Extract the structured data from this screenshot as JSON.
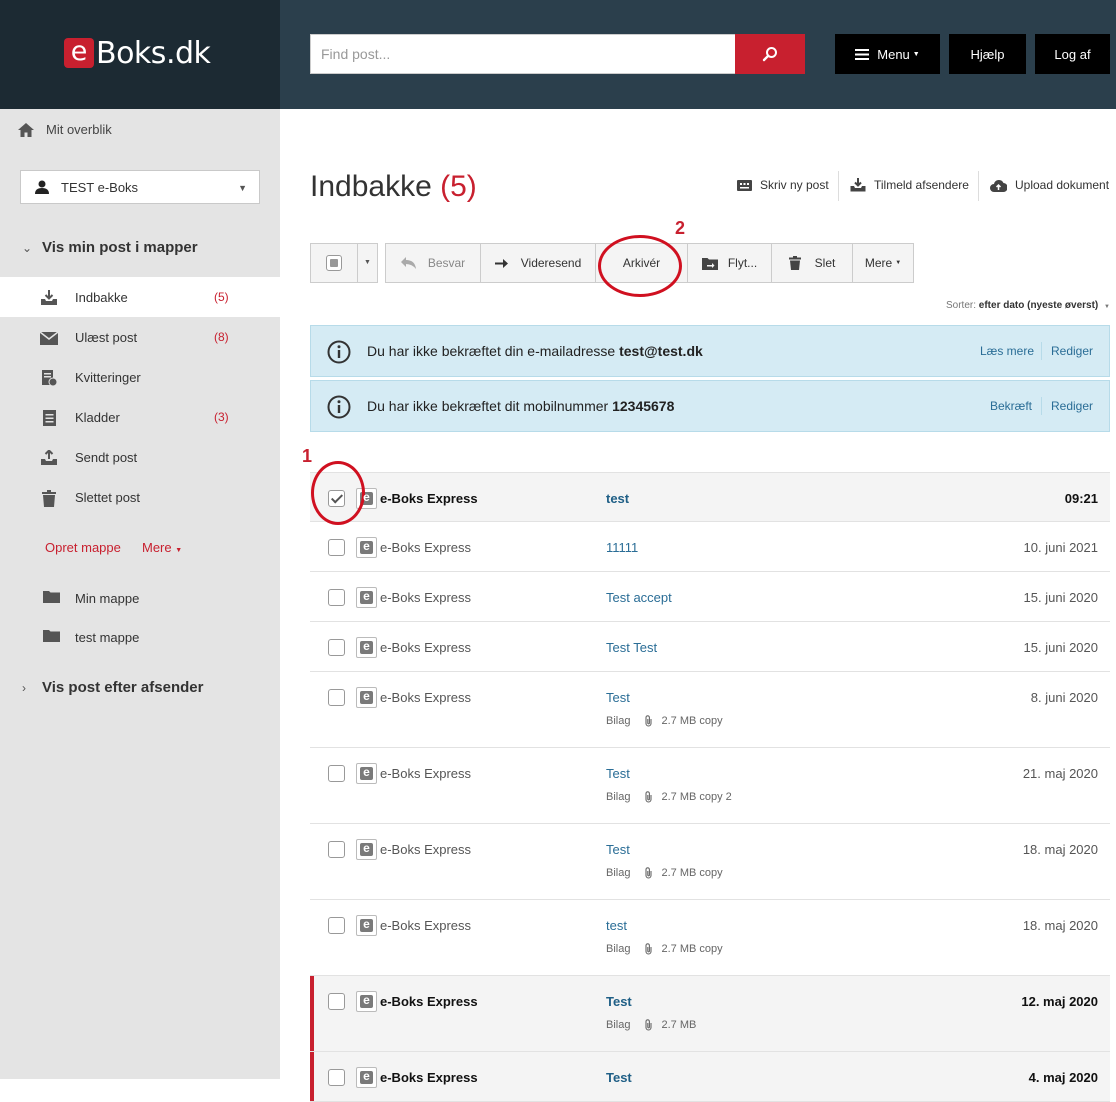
{
  "brand": {
    "e": "e",
    "rest": "Boks.dk"
  },
  "header": {
    "search_placeholder": "Find post...",
    "menu_label": "Menu",
    "help_label": "Hjælp",
    "logout_label": "Log af"
  },
  "sidebar": {
    "home_label": "Mit overblik",
    "user_label": "TEST e-Boks",
    "section_folders": "Vis min post i mapper",
    "items": [
      {
        "label": "Indbakke",
        "count": "(5)",
        "icon": "inbox-download-icon"
      },
      {
        "label": "Ulæst post",
        "count": "(8)",
        "icon": "envelope-icon"
      },
      {
        "label": "Kvitteringer",
        "count": "",
        "icon": "receipt-icon"
      },
      {
        "label": "Kladder",
        "count": "(3)",
        "icon": "draft-icon"
      },
      {
        "label": "Sendt post",
        "count": "",
        "icon": "upload-icon"
      },
      {
        "label": "Slettet post",
        "count": "",
        "icon": "trash-icon"
      }
    ],
    "create_folder": "Opret mappe",
    "more": "Mere",
    "folders": [
      "Min mappe",
      "test mappe"
    ],
    "section_sender": "Vis post efter afsender"
  },
  "main": {
    "title": "Indbakke",
    "title_count": "(5)",
    "actions": {
      "write": "Skriv ny post",
      "subscribe": "Tilmeld afsendere",
      "upload": "Upload dokument"
    },
    "toolbar": {
      "reply": "Besvar",
      "forward": "Videresend",
      "archive": "Arkivér",
      "move": "Flyt...",
      "delete": "Slet",
      "more": "Mere"
    },
    "sort_key": "Sorter:",
    "sort_value": "efter dato (nyeste øverst)",
    "notices": [
      {
        "text": "Du har ikke bekræftet din e-mailadresse ",
        "value": "test@test.dk",
        "link1": "Læs mere",
        "link2": "Rediger"
      },
      {
        "text": "Du har ikke bekræftet dit mobilnummer ",
        "value": "12345678",
        "link1": "Bekræft",
        "link2": "Rediger"
      }
    ],
    "messages": [
      {
        "sender": "e-Boks Express",
        "subject": "test",
        "date": "09:21",
        "unread": true,
        "checked": true,
        "attachment": ""
      },
      {
        "sender": "e-Boks Express",
        "subject": "11111",
        "date": "10. juni 2021",
        "unread": false,
        "checked": false,
        "attachment": ""
      },
      {
        "sender": "e-Boks Express",
        "subject": "Test accept",
        "date": "15. juni 2020",
        "unread": false,
        "checked": false,
        "attachment": ""
      },
      {
        "sender": "e-Boks Express",
        "subject": "Test Test",
        "date": "15. juni 2020",
        "unread": false,
        "checked": false,
        "attachment": ""
      },
      {
        "sender": "e-Boks Express",
        "subject": "Test",
        "date": "8. juni 2020",
        "unread": false,
        "checked": false,
        "attachment": "2.7 MB copy"
      },
      {
        "sender": "e-Boks Express",
        "subject": "Test",
        "date": "21. maj 2020",
        "unread": false,
        "checked": false,
        "attachment": "2.7 MB copy 2"
      },
      {
        "sender": "e-Boks Express",
        "subject": "Test",
        "date": "18. maj 2020",
        "unread": false,
        "checked": false,
        "attachment": "2.7 MB copy"
      },
      {
        "sender": "e-Boks Express",
        "subject": "test",
        "date": "18. maj 2020",
        "unread": false,
        "checked": false,
        "attachment": "2.7 MB copy"
      },
      {
        "sender": "e-Boks Express",
        "subject": "Test",
        "date": "12. maj 2020",
        "unread": true,
        "checked": false,
        "attachment": "2.7 MB"
      },
      {
        "sender": "e-Boks Express",
        "subject": "Test",
        "date": "4. maj 2020",
        "unread": true,
        "checked": false,
        "attachment": ""
      }
    ],
    "attachment_label": "Bilag",
    "e_glyph": "e"
  },
  "annotations": {
    "one": "1",
    "two": "2"
  },
  "colors": {
    "brand_red": "#c8202f",
    "header_bg": "#2b3f4c",
    "notice_bg": "#d5ebf4",
    "link_blue": "#2a6d96"
  }
}
